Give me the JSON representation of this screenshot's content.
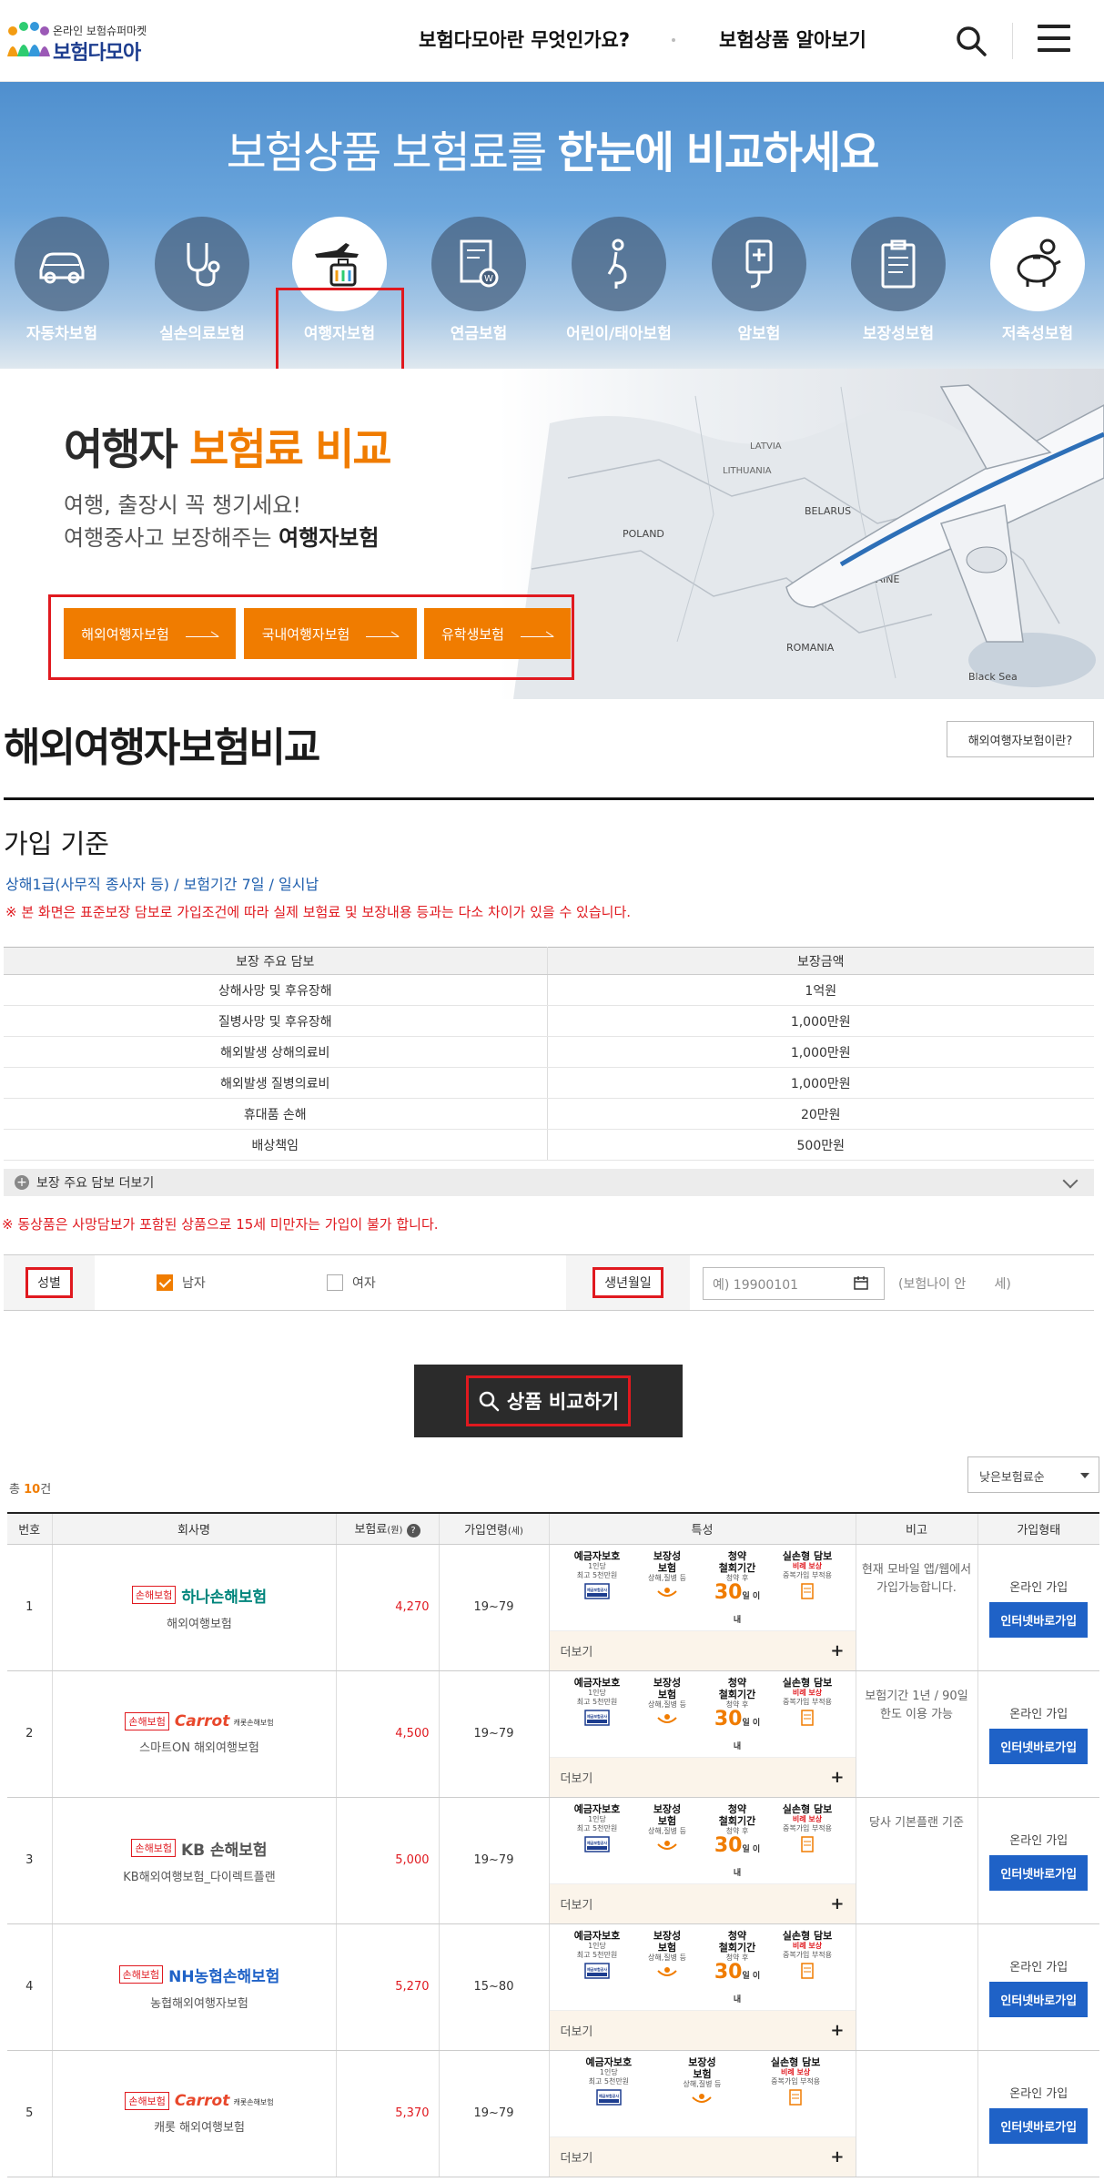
{
  "header": {
    "logo_tag": "온라인 보험슈퍼마켓",
    "logo_name": "보험다모아",
    "nav": [
      "보험다모아란 무엇인가요?",
      "보험상품 알아보기"
    ]
  },
  "hero": {
    "title_light": "보험상품 보험료를 ",
    "title_bold": "한눈에 비교하세요",
    "categories": [
      {
        "label": "자동차보험",
        "icon": "car-icon"
      },
      {
        "label": "실손의료보험",
        "icon": "stethoscope-icon"
      },
      {
        "label": "여행자보험",
        "icon": "travel-luggage-icon",
        "active": true
      },
      {
        "label": "연금보험",
        "icon": "pension-document-icon"
      },
      {
        "label": "어린이/태아보험",
        "icon": "pregnant-icon"
      },
      {
        "label": "암보험",
        "icon": "iv-bag-icon"
      },
      {
        "label": "보장성보험",
        "icon": "clipboard-icon"
      },
      {
        "label": "저축성보험",
        "icon": "piggy-bank-icon"
      }
    ]
  },
  "banner": {
    "title_black": "여행자 ",
    "title_orange": "보험료 비교",
    "sub1": "여행, 출장시 꼭 챙기세요!",
    "sub2_plain": "여행중사고 보장해주는 ",
    "sub2_bold": "여행자보험",
    "buttons": [
      "해외여행자보험",
      "국내여행자보험",
      "유학생보험"
    ],
    "map_labels": [
      "LATVIA",
      "LITHUANIA",
      "BELARUS",
      "POLAND",
      "UKRAINE",
      "ROMANIA",
      "Black Sea"
    ]
  },
  "section": {
    "title": "해외여행자보험비교",
    "about_button": "해외여행자보험이란?",
    "subtitle": "가입 기준",
    "conditions": "상해1급(사무직 종사자 등) / 보험기간 7일 / 일시납",
    "warning": "※ 본 화면은 표준보장 담보로 가입조건에 따라 실제 보험료 및 보장내용 등과는 다소 차이가 있을 수 있습니다."
  },
  "coverage": {
    "headers": [
      "보장 주요 담보",
      "보장금액"
    ],
    "rows": [
      [
        "상해사망 및 후유장해",
        "1억원"
      ],
      [
        "질병사망 및 후유장해",
        "1,000만원"
      ],
      [
        "해외발생 상해의료비",
        "1,000만원"
      ],
      [
        "해외발생 질병의료비",
        "1,000만원"
      ],
      [
        "휴대품 손해",
        "20만원"
      ],
      [
        "배상책임",
        "500만원"
      ]
    ],
    "more_label": "보장 주요 담보 더보기"
  },
  "warning2": "※ 동상품은 사망담보가 포함된 상품으로 15세 미만자는 가입이 불가 합니다.",
  "form": {
    "gender_label": "성별",
    "male": "남자",
    "female": "여자",
    "male_checked": true,
    "birth_label": "생년월일",
    "birth_placeholder": "예) 19900101",
    "age_text": "(보험나이 안",
    "age_unit": "세)"
  },
  "compare_button": "상품 비교하기",
  "results": {
    "total_prefix": "총 ",
    "total_count": "10",
    "total_suffix": "건",
    "sort": "낮은보험료순",
    "headers": [
      "번호",
      "회사명",
      "보험료",
      "(원)",
      "가입연령",
      "(세)",
      "특성",
      "비고",
      "가입형태"
    ],
    "rows": [
      {
        "no": "1",
        "badge": "손해보험",
        "brand": "하나손해보험",
        "brand_color": "#00857c",
        "product": "해외여행보험",
        "price": "4,270",
        "age": "19~79",
        "note": "현재 모바일 앱/웹에서 가입가능합니다.",
        "withdraw": true
      },
      {
        "no": "2",
        "badge": "손해보험",
        "brand": "Carrot",
        "brand_sub": "캐롯손해보험",
        "brand_color": "#e8472b",
        "product": "스마트ON 해외여행보험",
        "price": "4,500",
        "age": "19~79",
        "note": "보험기간 1년 / 90일 한도 이용 가능",
        "withdraw": true
      },
      {
        "no": "3",
        "badge": "손해보험",
        "brand": "KB 손해보험",
        "brand_color": "#555555",
        "product": "KB해외여행보험_다이렉트플랜",
        "price": "5,000",
        "age": "19~79",
        "note": "당사 기본플랜 기준",
        "withdraw": true
      },
      {
        "no": "4",
        "badge": "손해보험",
        "brand": "NH농협손해보험",
        "brand_color": "#1f62c7",
        "product": "농협해외여행자보험",
        "price": "5,270",
        "age": "15~80",
        "note": "",
        "withdraw": true
      },
      {
        "no": "5",
        "badge": "손해보험",
        "brand": "Carrot",
        "brand_sub": "캐롯손해보험",
        "brand_color": "#e8472b",
        "product": "캐롯 해외여행보험",
        "price": "5,370",
        "age": "19~79",
        "note": "",
        "withdraw": false
      }
    ],
    "feature_tiles": {
      "deposit": {
        "title1": "예금자보호",
        "line1": "1인당",
        "line2": "최고 5천만원",
        "seal": "예금보험공사"
      },
      "guarantee": {
        "title1": "보장성",
        "title2": "보험",
        "line1": "상해,질병 등"
      },
      "withdraw": {
        "title1": "청약",
        "title2": "철회기간",
        "line1": "청약 후",
        "big": "30",
        "unit": "일 이내"
      },
      "indemnity": {
        "title1": "실손형 담보",
        "red": "비례 보상",
        "line1": "중복가입 부적용"
      }
    },
    "more_label": "더보기",
    "join_type": "온라인 가입",
    "join_button": "인터넷바로가입"
  }
}
